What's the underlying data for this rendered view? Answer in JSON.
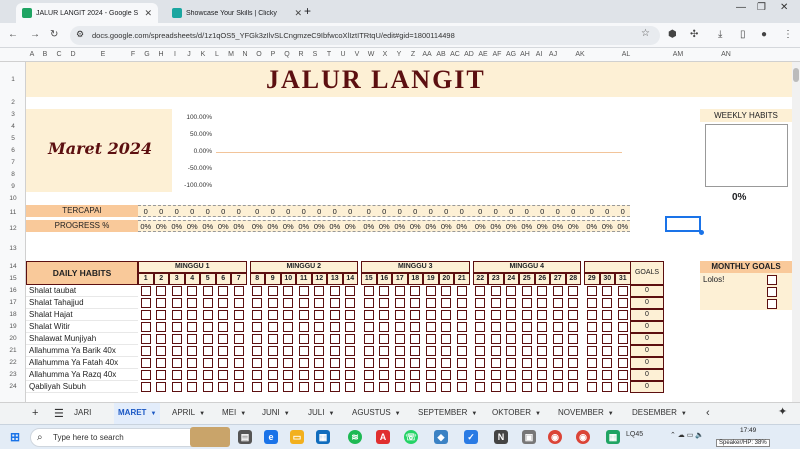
{
  "browser": {
    "tabs": [
      {
        "title": "JALUR LANGIT 2024 - Google S",
        "active": true,
        "icon_color": "#1fa463",
        "icon": "sheets-icon"
      },
      {
        "title": "Showcase Your Skills | Clicky",
        "active": false,
        "icon_color": "#1aa6a0",
        "icon": "clicky-icon"
      }
    ],
    "new_tab": "+",
    "url": "docs.google.com/spreadsheets/d/1z1qOS5_YFGk3zIlvSLCngmzeC9IbfwcoXlIztITRtqU/edit#gid=1800114498"
  },
  "columns": [
    "A",
    "B",
    "C",
    "D",
    "E",
    "F",
    "G",
    "H",
    "I",
    "J",
    "K",
    "L",
    "M",
    "N",
    "O",
    "P",
    "Q",
    "R",
    "S",
    "T",
    "U",
    "V",
    "W",
    "X",
    "Y",
    "Z",
    "AA",
    "AB",
    "AC",
    "AD",
    "AE",
    "AF",
    "AG",
    "AH",
    "AI",
    "AJ",
    "AK",
    "AL",
    "AM",
    "AN"
  ],
  "rows": [
    "1",
    "2",
    "3",
    "4",
    "5",
    "6",
    "7",
    "8",
    "9",
    "10",
    "11",
    "12",
    "13",
    "14",
    "15",
    "16",
    "17",
    "18",
    "19",
    "20",
    "21",
    "22",
    "23",
    "24"
  ],
  "sheet": {
    "title": "JALUR LANGIT",
    "month": "Maret 2024",
    "chart_data": {
      "type": "line",
      "yticks": [
        "100.00%",
        "50.00%",
        "0.00%",
        "-50.00%",
        "-100.00%"
      ],
      "ylim": [
        -100,
        100
      ],
      "series": [
        {
          "values": [
            0,
            0,
            0,
            0,
            0,
            0,
            0,
            0,
            0,
            0,
            0,
            0,
            0,
            0,
            0,
            0,
            0,
            0,
            0,
            0,
            0,
            0,
            0,
            0,
            0,
            0,
            0,
            0,
            0,
            0,
            0
          ]
        }
      ]
    },
    "tercapai_label": "TERCAPAI",
    "progress_label": "PROGRESS %",
    "tercapai": [
      "0",
      "0",
      "0",
      "0",
      "0",
      "0",
      "0",
      "0",
      "0",
      "0",
      "0",
      "0",
      "0",
      "0",
      "0",
      "0",
      "0",
      "0",
      "0",
      "0",
      "0",
      "0",
      "0",
      "0",
      "0",
      "0",
      "0",
      "0",
      "0",
      "0",
      "0"
    ],
    "progress": [
      "0%",
      "0%",
      "0%",
      "0%",
      "0%",
      "0%",
      "0%",
      "0%",
      "0%",
      "0%",
      "0%",
      "0%",
      "0%",
      "0%",
      "0%",
      "0%",
      "0%",
      "0%",
      "0%",
      "0%",
      "0%",
      "0%",
      "0%",
      "0%",
      "0%",
      "0%",
      "0%",
      "0%",
      "0%",
      "0%",
      "0%"
    ],
    "daily_habits_label": "DAILY HABITS",
    "weeks": [
      "MINGGU 1",
      "MINGGU 2",
      "MINGGU 3",
      "MINGGU 4"
    ],
    "days": [
      "1",
      "2",
      "3",
      "4",
      "5",
      "6",
      "7",
      "8",
      "9",
      "10",
      "11",
      "12",
      "13",
      "14",
      "15",
      "16",
      "17",
      "18",
      "19",
      "20",
      "21",
      "22",
      "23",
      "24",
      "25",
      "26",
      "27",
      "28",
      "29",
      "30",
      "31"
    ],
    "goals_label": "GOALS",
    "habits": [
      {
        "name": "Shalat taubat",
        "goal": "0"
      },
      {
        "name": "Shalat Tahajjud",
        "goal": "0"
      },
      {
        "name": "Shalat Hajat",
        "goal": "0"
      },
      {
        "name": "Shalat Witir",
        "goal": "0"
      },
      {
        "name": "Shalawat Munjiyah",
        "goal": "0"
      },
      {
        "name": "Allahumma Ya Barik 40x",
        "goal": "0"
      },
      {
        "name": "Allahumma Ya Fatah 40x",
        "goal": "0"
      },
      {
        "name": "Allahumma Ya Razq 40x",
        "goal": "0"
      },
      {
        "name": "Qabliyah Subuh",
        "goal": "0"
      }
    ],
    "weekly_habits_label": "WEEKLY HABITS",
    "weekly_pct": "0%",
    "monthly_goals_label": "MONTHLY GOALS",
    "monthly_goals": [
      "Lolos!",
      "",
      ""
    ]
  },
  "sheet_tabs": [
    "JARI",
    "MARET",
    "APRIL",
    "MEI",
    "JUNI",
    "JULI",
    "AGUSTUS",
    "SEPTEMBER",
    "OKTOBER",
    "NOVEMBER",
    "DESEMBER"
  ],
  "active_sheet": "MARET",
  "taskbar": {
    "search_placeholder": "Type here to search",
    "tray_text": "LQ45",
    "time": "17:49",
    "speaker": "Speaker/HP: 38%"
  }
}
